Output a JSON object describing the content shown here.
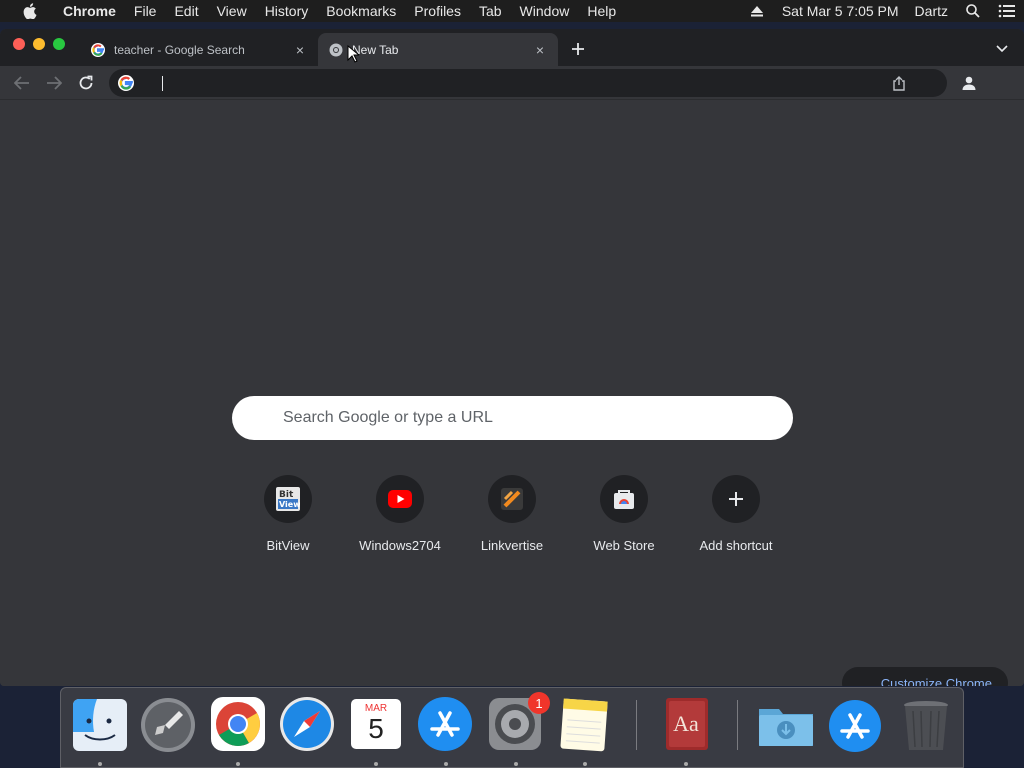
{
  "menubar": {
    "app_name": "Chrome",
    "items": [
      "File",
      "Edit",
      "View",
      "History",
      "Bookmarks",
      "Profiles",
      "Tab",
      "Window",
      "Help"
    ],
    "clock": "Sat Mar 5  7:05 PM",
    "user": "Dartz"
  },
  "tabs": [
    {
      "title": "teacher - Google Search",
      "favicon": "google-g-icon",
      "close": "×"
    },
    {
      "title": "New Tab",
      "favicon": "chrome-icon",
      "close": "×"
    }
  ],
  "omnibox": {
    "value": ""
  },
  "ntp": {
    "search_placeholder": "Search Google or type a URL",
    "shortcuts": [
      {
        "label": "BitView",
        "icon": "bitview-icon"
      },
      {
        "label": "Windows2704",
        "icon": "youtube-icon"
      },
      {
        "label": "Linkvertise",
        "icon": "linkvertise-icon"
      },
      {
        "label": "Web Store",
        "icon": "web-store-icon"
      },
      {
        "label": "Add shortcut",
        "icon": "plus-icon"
      }
    ],
    "customize_label": "Customize Chrome"
  },
  "dock": {
    "calendar_month": "MAR",
    "calendar_day": "5",
    "settings_badge": "1",
    "dictionary_label": "Aa"
  },
  "colors": {
    "window_bg": "#35363a",
    "tabstrip_bg": "#202124",
    "accent_link": "#8ab4f8"
  }
}
